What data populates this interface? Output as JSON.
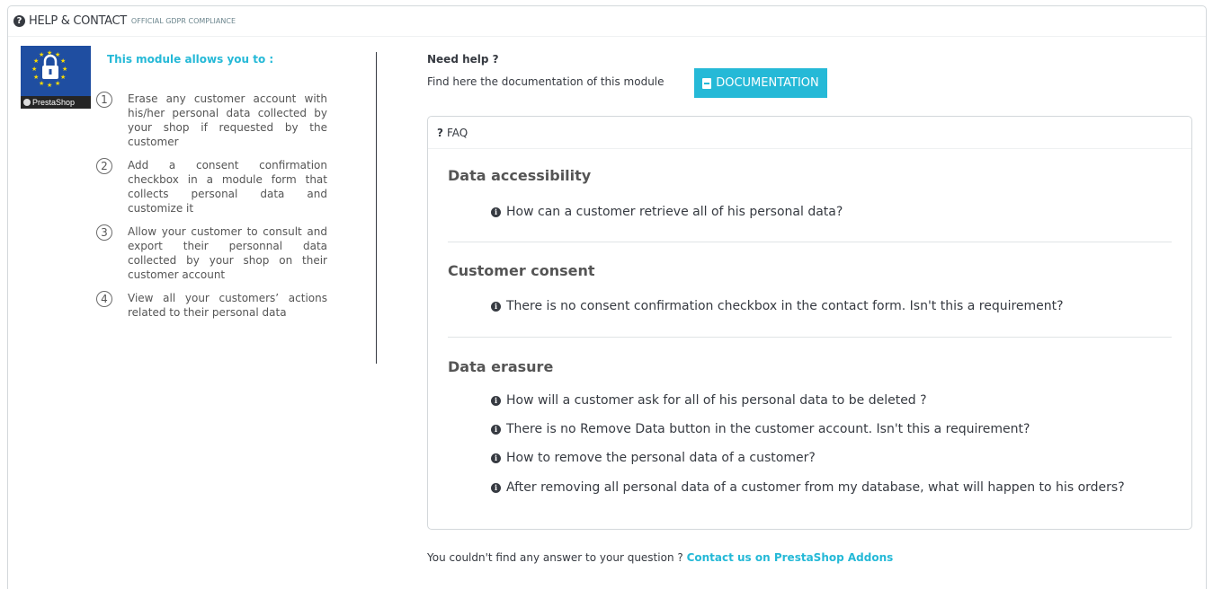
{
  "panel": {
    "title": "HELP & CONTACT",
    "subtitle": "OFFICIAL GDPR COMPLIANCE"
  },
  "module": {
    "logo_text": "PrestaShop",
    "allows_title": "This module allows you to :",
    "features": [
      {
        "num": "1",
        "text": "Erase any customer account with his/her personal data collected by your shop if requested by the customer"
      },
      {
        "num": "2",
        "text": "Add a consent confirmation checkbox in a module form that collects personal data and customize it"
      },
      {
        "num": "3",
        "text": "Allow your customer to consult and export their personnal data collected by your shop on their customer account"
      },
      {
        "num": "4",
        "text": "View all your customers’ actions related to their personal data"
      }
    ]
  },
  "help": {
    "need_help": "Need help ?",
    "find_here": "Find here the documentation of this module",
    "doc_button": "DOCUMENTATION"
  },
  "faq": {
    "heading_icon": "?",
    "heading": "FAQ",
    "categories": [
      {
        "title": "Data accessibility",
        "questions": [
          "How can a customer retrieve all of his personal data?"
        ]
      },
      {
        "title": "Customer consent",
        "questions": [
          "There is no consent confirmation checkbox in the contact form. Isn't this a requirement?"
        ]
      },
      {
        "title": "Data erasure",
        "questions": [
          "How will a customer ask for all of his personal data to be deleted ?",
          "There is no Remove Data button in the customer account. Isn't this a requirement?",
          "How to remove the personal data of a customer?",
          "After removing all personal data of a customer from my database, what will happen to his orders?"
        ]
      }
    ]
  },
  "footer": {
    "question": "You couldn't find any answer to your question ?",
    "contact_link": "Contact us on PrestaShop Addons"
  },
  "colors": {
    "accent": "#25b9d7",
    "text": "#363a41",
    "logo_bg": "#1f4ea1"
  }
}
